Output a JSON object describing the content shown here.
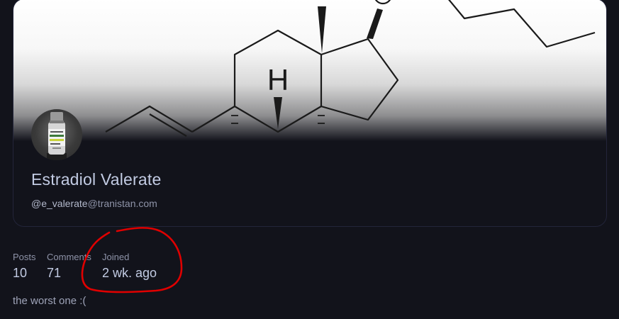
{
  "profile": {
    "name": "Estradiol Valerate",
    "handle_user": "@e_valerate",
    "handle_domain": "@tranistan.com",
    "bio": "the worst one :("
  },
  "banner": {
    "atom_label": "H"
  },
  "stats": {
    "posts_label": "Posts",
    "posts_value": "10",
    "comments_label": "Comments",
    "comments_value": "71",
    "joined_label": "Joined",
    "joined_value": "2 wk. ago"
  },
  "colors": {
    "background": "#12131b",
    "name_text": "#c2cbe3",
    "muted_text": "#8e93a8",
    "annotation": "#e00000"
  },
  "icons": {
    "avatar": "medication-vial-photo"
  }
}
